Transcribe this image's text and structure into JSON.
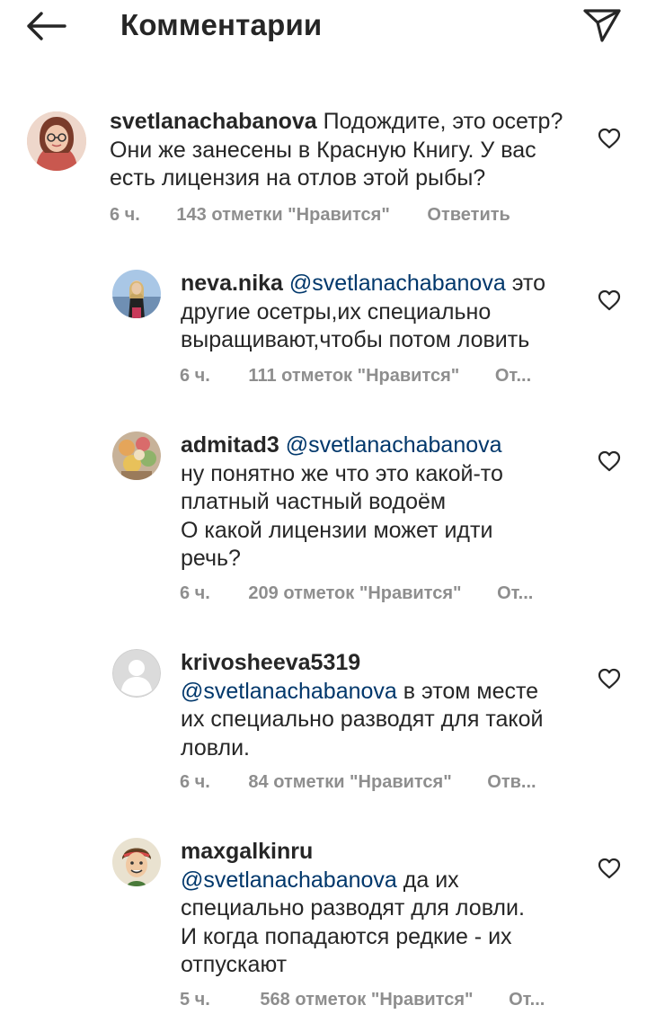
{
  "header": {
    "title": "Комментарии",
    "back_icon": "arrow-left-icon",
    "share_icon": "paper-plane-icon"
  },
  "comments": [
    {
      "username": "svetlanachabanova",
      "mention": "",
      "lines": [
        "Подождите, это осетр?",
        "Они же занесены в Красную Книгу. У вас",
        "есть лицензия на отлов этой рыбы?"
      ],
      "time": "6 ч.",
      "likes": "143 отметки \"Нравится\"",
      "reply": "Ответить"
    },
    {
      "username": "neva.nika",
      "mention": "@svetlanachabanova",
      "lines": [
        "это",
        "другие осетры,их специально",
        "выращивают,чтобы потом ловить"
      ],
      "time": "6 ч.",
      "likes": "111 отметок \"Нравится\"",
      "reply": "От..."
    },
    {
      "username": "admitad3",
      "mention": "@svetlanachabanova",
      "lines": [
        "",
        "ну понятно же что это какой-то",
        "платный частный водоём",
        "О какой лицензии может идти",
        "речь?"
      ],
      "time": "6 ч.",
      "likes": "209 отметок \"Нравится\"",
      "reply": "От..."
    },
    {
      "username": "krivosheeva5319",
      "mention": "@svetlanachabanova",
      "lines": [
        "в этом месте",
        "их специально разводят для такой",
        "ловли."
      ],
      "time": "6 ч.",
      "likes": "84 отметки \"Нравится\"",
      "reply": "Отв..."
    },
    {
      "username": "maxgalkinru",
      "mention": "@svetlanachabanova",
      "lines": [
        "да их",
        "специально разводят для ловли.",
        "И когда попадаются редкие - их",
        "отпускают"
      ],
      "time": "5 ч.",
      "likes": "568 отметок \"Нравится\"",
      "reply": "От..."
    }
  ],
  "colors": {
    "text": "#262626",
    "meta": "#8e8e8e",
    "mention": "#00376b",
    "background": "#ffffff"
  }
}
